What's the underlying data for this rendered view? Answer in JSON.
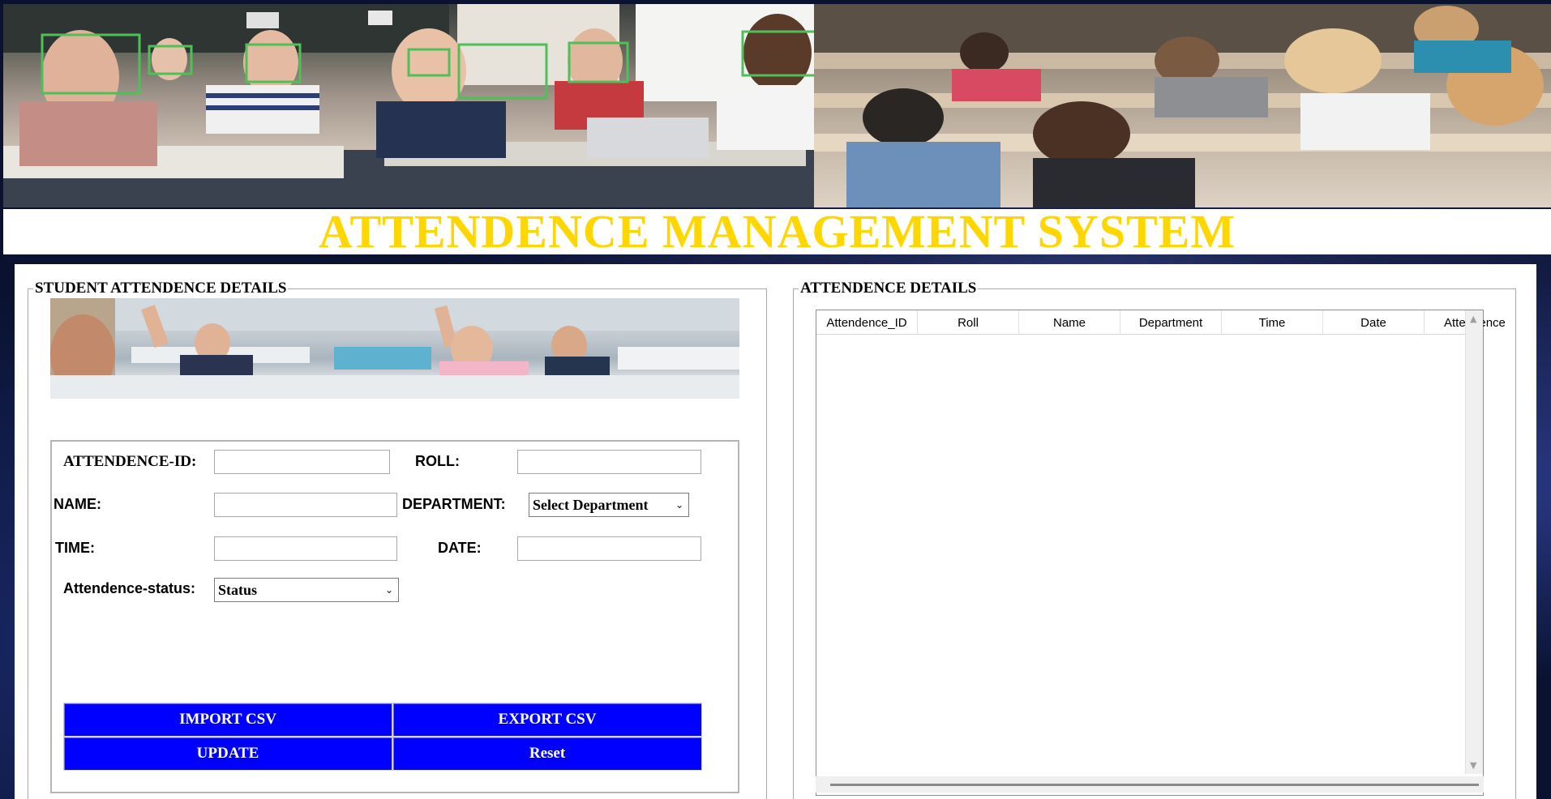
{
  "app": {
    "title": "ATTENDENCE MANAGEMENT SYSTEM"
  },
  "left_panel": {
    "title": "STUDENT ATTENDENCE DETAILS",
    "labels": {
      "attendance_id": "ATTENDENCE-ID:",
      "roll": "ROLL:",
      "name": "NAME:",
      "department": "DEPARTMENT:",
      "time": "TIME:",
      "date": "DATE:",
      "status": "Attendence-status:"
    },
    "fields": {
      "attendance_id": "",
      "roll": "",
      "name": "",
      "time": "",
      "date": ""
    },
    "department_select": "Select Department",
    "status_select": "Status",
    "buttons": {
      "import_csv": "IMPORT CSV",
      "export_csv": "EXPORT CSV",
      "update": "UPDATE",
      "reset": "Reset"
    }
  },
  "right_panel": {
    "title": "ATTENDENCE DETAILS",
    "columns": [
      "Attendence_ID",
      "Roll",
      "Name",
      "Department",
      "Time",
      "Date",
      "Attendence"
    ],
    "rows": []
  },
  "colors": {
    "title_yellow": "#ffd700",
    "button_blue": "#0000ff"
  },
  "icons": {
    "combo_arrow": "chevron-down-icon",
    "scroll_up": "scroll-up-arrow-icon",
    "scroll_down": "scroll-down-arrow-icon"
  }
}
